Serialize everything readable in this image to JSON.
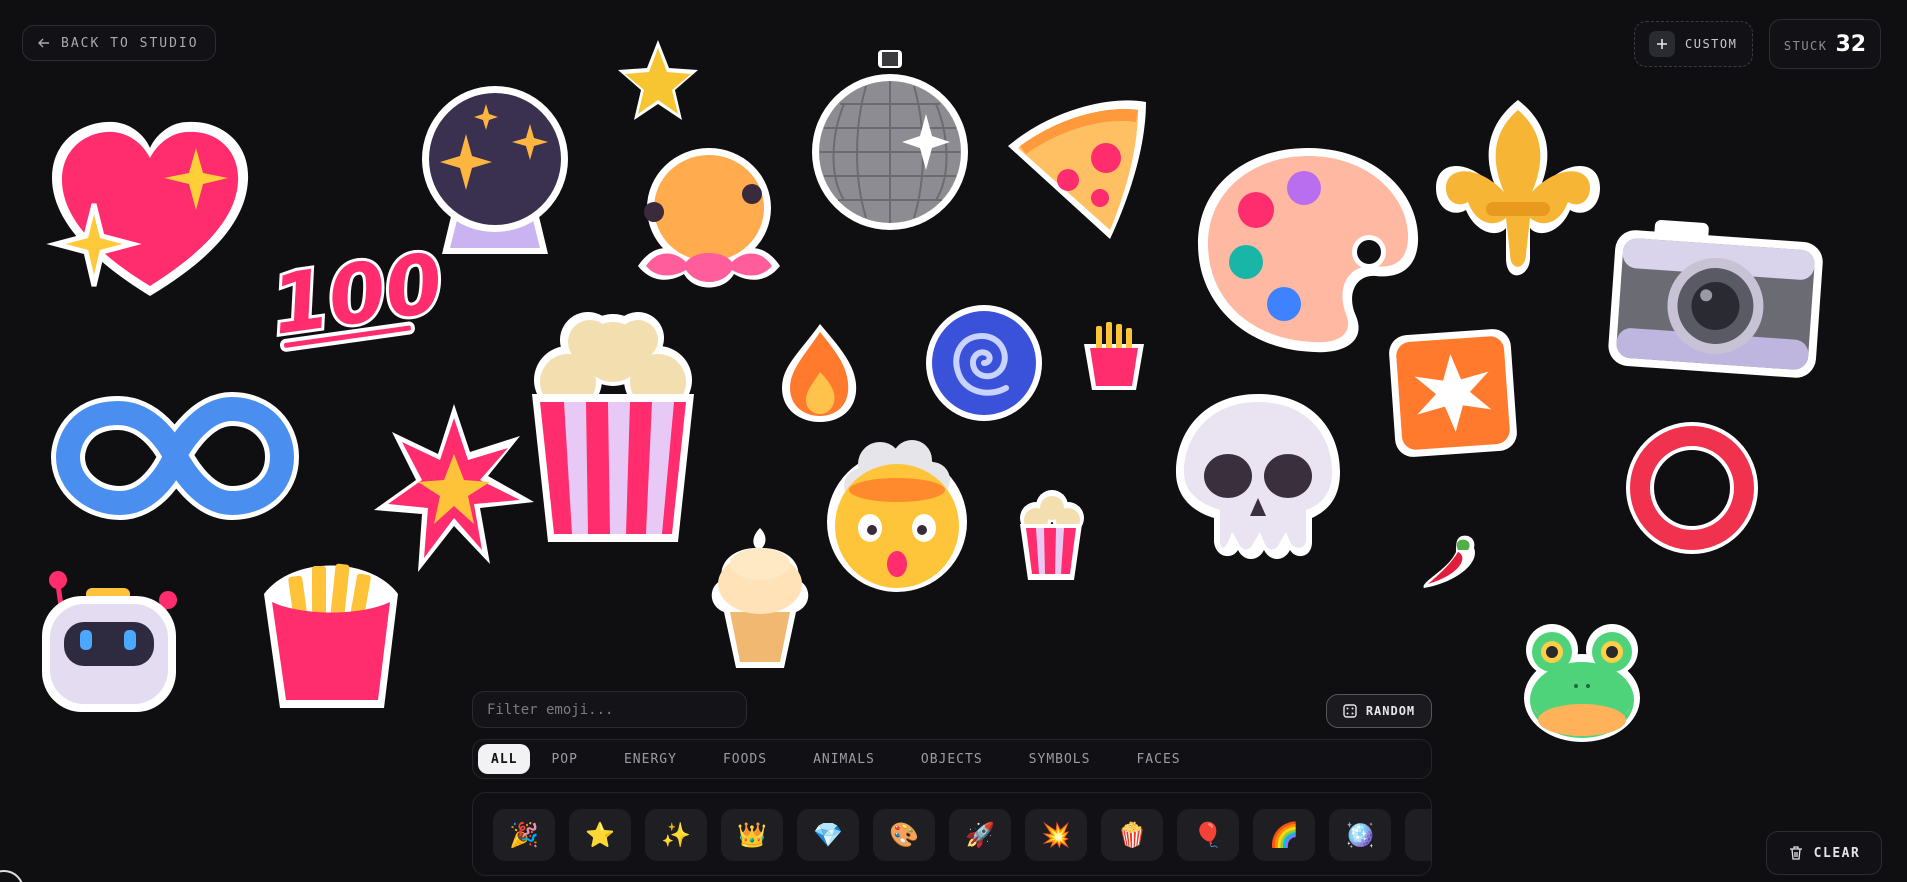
{
  "header": {
    "back_label": "BACK TO STUDIO",
    "custom_label": "CUSTOM",
    "stuck_label": "STUCK",
    "stuck_count": "32"
  },
  "stickers": {
    "hundred_text": "100"
  },
  "filter": {
    "placeholder": "Filter emoji..."
  },
  "random_label": "RANDOM",
  "tabs": [
    {
      "label": "ALL",
      "active": true
    },
    {
      "label": "POP"
    },
    {
      "label": "ENERGY"
    },
    {
      "label": "FOODS"
    },
    {
      "label": "ANIMALS"
    },
    {
      "label": "OBJECTS"
    },
    {
      "label": "SYMBOLS"
    },
    {
      "label": "FACES"
    }
  ],
  "tray": [
    "🎉",
    "⭐",
    "✨",
    "👑",
    "💎",
    "🎨",
    "🚀",
    "💥",
    "🍿",
    "🎈",
    "🌈",
    "🪩"
  ],
  "clear_label": "CLEAR",
  "colors": {
    "background": "#0f0f12",
    "accent_pink": "#ff2d7a",
    "accent_orange": "#ff7a2d",
    "accent_blue": "#3f82ff"
  }
}
